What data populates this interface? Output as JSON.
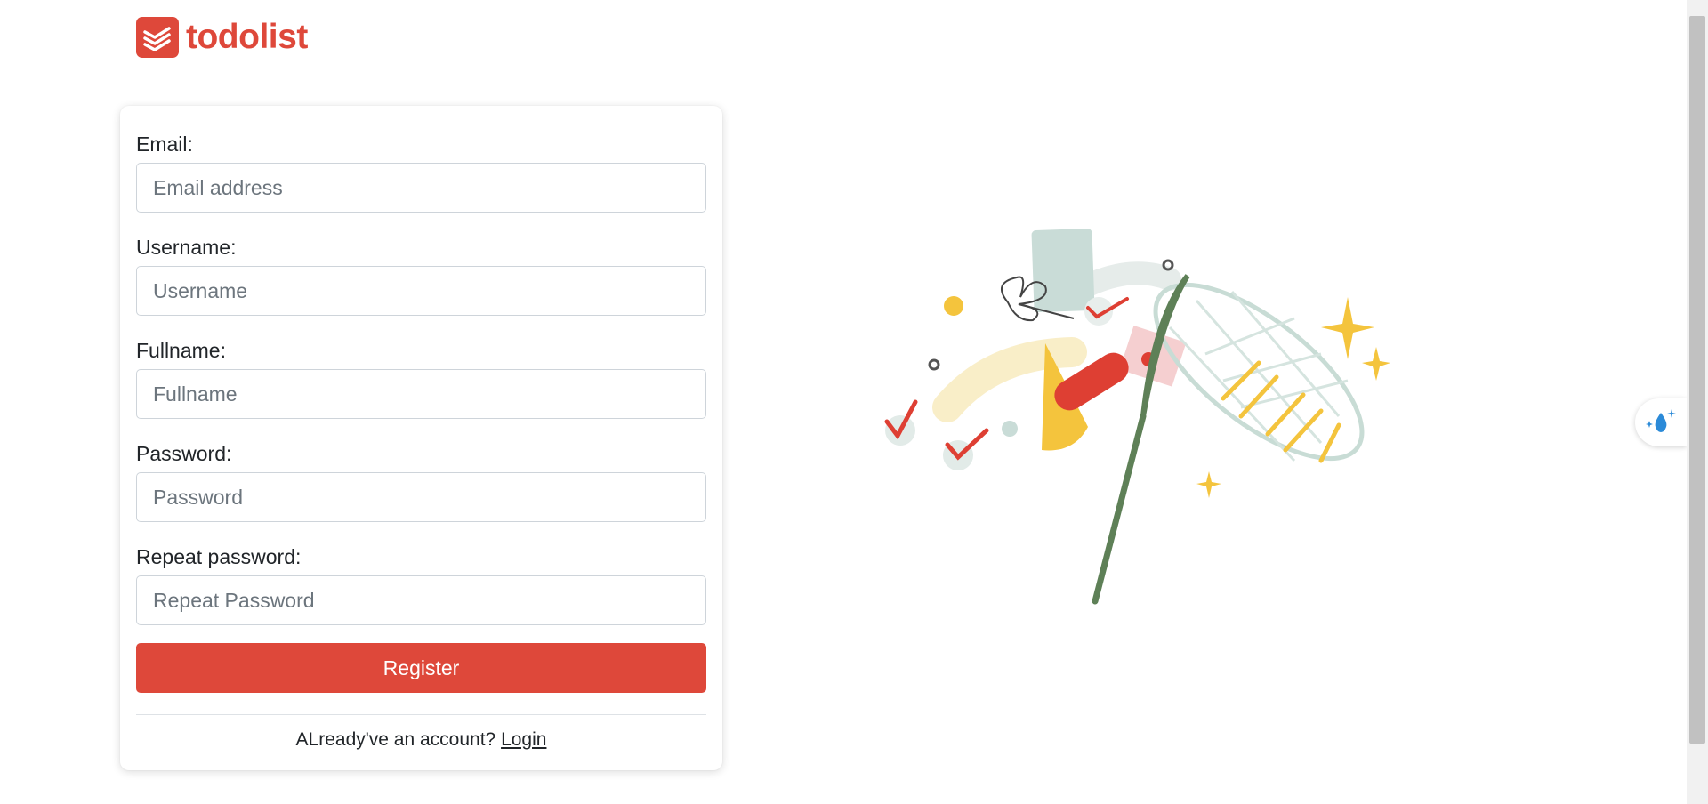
{
  "brand": {
    "name": "todolist",
    "color": "#de483a"
  },
  "form": {
    "email": {
      "label": "Email:",
      "placeholder": "Email address",
      "value": ""
    },
    "username": {
      "label": "Username:",
      "placeholder": "Username",
      "value": ""
    },
    "fullname": {
      "label": "Fullname:",
      "placeholder": "Fullname",
      "value": ""
    },
    "password": {
      "label": "Password:",
      "placeholder": "Password",
      "value": ""
    },
    "repeat_password": {
      "label": "Repeat password:",
      "placeholder": "Repeat Password",
      "value": ""
    },
    "submit_label": "Register"
  },
  "footer": {
    "prompt": "ALready've an account?",
    "login_link": "Login"
  },
  "illustration": {
    "name": "butterfly-net-catching-tasks"
  },
  "side_widget": {
    "icon": "water-drop-sparkle-icon"
  }
}
